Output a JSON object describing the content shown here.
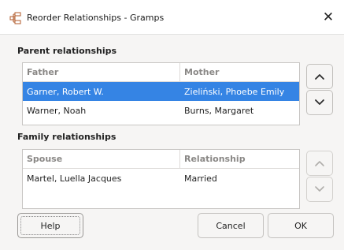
{
  "window": {
    "title": "Reorder Relationships - Gramps",
    "close_glyph": "✕"
  },
  "parents": {
    "section_label": "Parent relationships",
    "columns": [
      "Father",
      "Mother"
    ],
    "rows": [
      {
        "father": "Garner, Robert W.",
        "mother": "Zieliński, Phoebe Emily",
        "selected": true
      },
      {
        "father": "Warner, Noah",
        "mother": "Burns, Margaret",
        "selected": false
      }
    ],
    "up_icon": "chevron-up-icon",
    "down_icon": "chevron-down-icon"
  },
  "families": {
    "section_label": "Family relationships",
    "columns": [
      "Spouse",
      "Relationship"
    ],
    "rows": [
      {
        "spouse": "Martel, Luella Jacques",
        "relationship": "Married",
        "selected": false
      }
    ],
    "up_icon": "chevron-up-icon",
    "down_icon": "chevron-down-icon"
  },
  "buttons": {
    "help": "Help",
    "cancel": "Cancel",
    "ok": "OK"
  },
  "colors": {
    "selection": "#3584e4",
    "disabled_arrow": "#b0aeab",
    "enabled_arrow": "#2e2e2e"
  }
}
